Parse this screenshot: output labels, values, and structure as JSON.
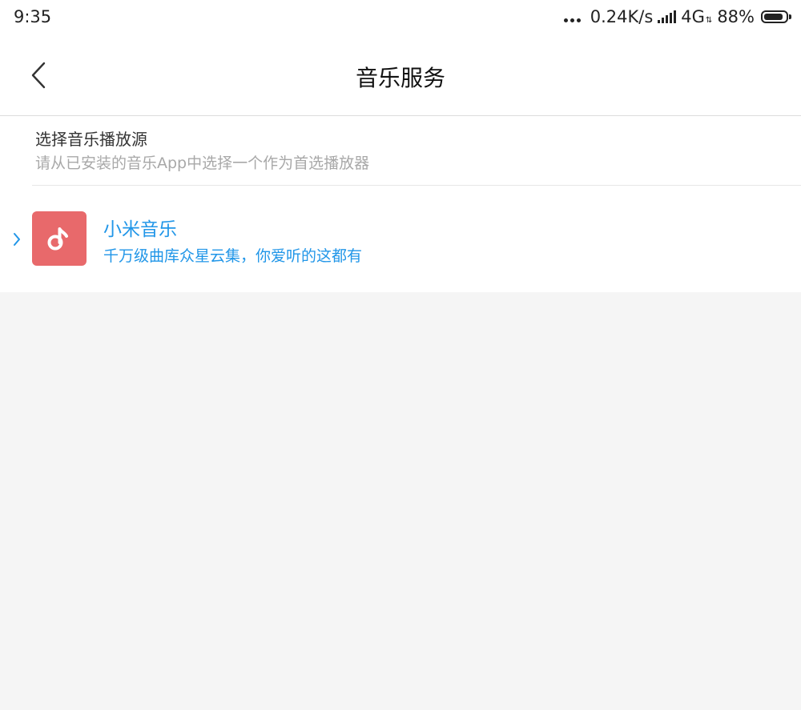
{
  "status_bar": {
    "time": "9:35",
    "network_speed": "0.24K/s",
    "network_type": "4G",
    "network_arrows": "⇅",
    "battery_percent": "88%",
    "battery_level": 0.88
  },
  "header": {
    "title": "音乐服务"
  },
  "section": {
    "title": "选择音乐播放源",
    "subtitle": "请从已安装的音乐App中选择一个作为首选播放器"
  },
  "players": [
    {
      "name": "小米音乐",
      "description": "千万级曲库众星云集，你爱听的这都有",
      "icon": "music-note-icon",
      "icon_color": "#e8696b",
      "selected": true
    }
  ],
  "colors": {
    "accent": "#2196e8",
    "background": "#f5f5f5"
  }
}
